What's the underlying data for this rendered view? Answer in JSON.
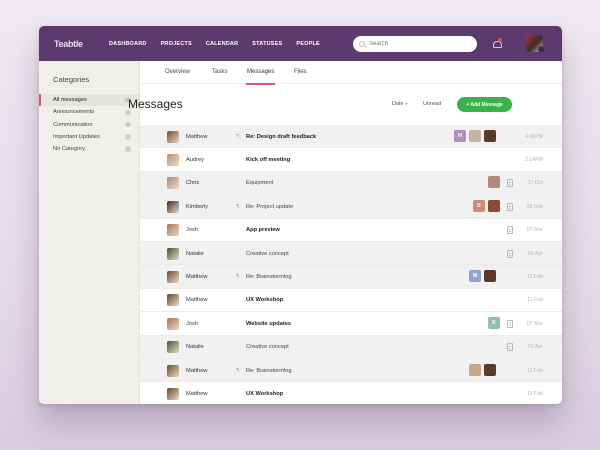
{
  "app": {
    "logo": "Teabtle",
    "nav": [
      "DASHBOARD",
      "PROJECTS",
      "CALENDAR",
      "STATUSES",
      "PEOPLE"
    ],
    "search_placeholder": "Search",
    "brand_color": "#5d3a6e",
    "accent_color": "#e0566a",
    "button_color": "#3ab24a"
  },
  "sidebar": {
    "title": "Categories",
    "items": [
      {
        "label": "All messages",
        "count": "12",
        "active": true
      },
      {
        "label": "Announcements",
        "count": "0"
      },
      {
        "label": "Communication",
        "count": "5"
      },
      {
        "label": "Important Updates",
        "count": "2"
      },
      {
        "label": "No Category",
        "count": "0"
      }
    ]
  },
  "tabs": [
    {
      "label": "Overview"
    },
    {
      "label": "Tasks"
    },
    {
      "label": "Messages",
      "active": true
    },
    {
      "label": "Files"
    }
  ],
  "main": {
    "title": "Messages",
    "date_filter": "Date",
    "unread_filter": "Unread",
    "add_button": "+ Add Message"
  },
  "messages": [
    {
      "sender": "Matthew",
      "subject": "Re: Design draft feedback",
      "reply": true,
      "unread": true,
      "date": "4:46PM",
      "shaded": true,
      "avatar": "#7a4a2a",
      "participants": [
        {
          "initial": "H",
          "color": "#b48ec0"
        },
        {
          "initial": "",
          "color": "#c7b6a8"
        },
        {
          "initial": "",
          "color": "#5a3a2a"
        }
      ],
      "attachment": false
    },
    {
      "sender": "Audrey",
      "subject": "Kick off meeting",
      "reply": false,
      "unread": true,
      "date": "2:14PM",
      "shaded": false,
      "avatar": "#c98f6a",
      "participants": [],
      "attachment": false
    },
    {
      "sender": "Chris",
      "subject": "Equipment",
      "reply": false,
      "unread": false,
      "date": "17 Oct",
      "shaded": true,
      "avatar": "#a98b7a",
      "participants": [
        {
          "initial": "",
          "color": "#b08a7a"
        }
      ],
      "attachment": true
    },
    {
      "sender": "Kimberly",
      "subject": "Re: Project update",
      "reply": true,
      "unread": false,
      "date": "19 Sep",
      "shaded": true,
      "avatar": "#3a2a22",
      "participants": [
        {
          "initial": "S",
          "color": "#d0897a"
        },
        {
          "initial": "",
          "color": "#8a4a3a"
        }
      ],
      "attachment": true
    },
    {
      "sender": "Josh",
      "subject": "App preview",
      "reply": false,
      "unread": true,
      "date": "07 Mar",
      "shaded": false,
      "avatar": "#b07050",
      "participants": [],
      "attachment": true
    },
    {
      "sender": "Natalie",
      "subject": "Creative concept",
      "reply": false,
      "unread": false,
      "date": "03 Apr",
      "shaded": true,
      "avatar": "#3a5a2a",
      "participants": [],
      "attachment": true
    },
    {
      "sender": "Matthew",
      "subject": "Re: Brainstorming",
      "reply": true,
      "unread": false,
      "date": "12 Feb",
      "shaded": true,
      "avatar": "#6a4a2a",
      "participants": [
        {
          "initial": "M",
          "color": "#8fa6c8"
        },
        {
          "initial": "",
          "color": "#5a3a2a"
        }
      ],
      "attachment": false
    },
    {
      "sender": "Matthew",
      "subject": "UX Workshop",
      "reply": false,
      "unread": true,
      "date": "11 Feb",
      "shaded": false,
      "avatar": "#6a4a2a",
      "participants": [],
      "attachment": false
    },
    {
      "sender": "Josh",
      "subject": "Website updates",
      "reply": false,
      "unread": true,
      "date": "07 Mar",
      "shaded": false,
      "avatar": "#b07050",
      "participants": [
        {
          "initial": "K",
          "color": "#8fc0a8"
        }
      ],
      "attachment": true
    },
    {
      "sender": "Natalie",
      "subject": "Creative concept",
      "reply": false,
      "unread": false,
      "date": "03 Apr",
      "shaded": true,
      "avatar": "#3a5a2a",
      "participants": [],
      "attachment": true
    },
    {
      "sender": "Matthew",
      "subject": "Re: Brainstorming",
      "reply": true,
      "unread": false,
      "date": "12 Feb",
      "shaded": true,
      "avatar": "#6a4a2a",
      "participants": [
        {
          "initial": "",
          "color": "#c8a888"
        },
        {
          "initial": "",
          "color": "#5a3a2a"
        }
      ],
      "attachment": false
    },
    {
      "sender": "Matthew",
      "subject": "UX Workshop",
      "reply": false,
      "unread": true,
      "date": "11 Feb",
      "shaded": false,
      "avatar": "#6a4a2a",
      "participants": [],
      "attachment": false
    }
  ]
}
